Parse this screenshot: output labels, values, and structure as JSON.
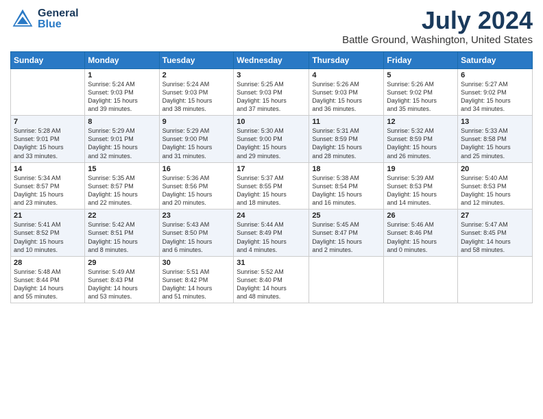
{
  "header": {
    "logo_general": "General",
    "logo_blue": "Blue",
    "title": "July 2024",
    "subtitle": "Battle Ground, Washington, United States"
  },
  "calendar": {
    "days": [
      "Sunday",
      "Monday",
      "Tuesday",
      "Wednesday",
      "Thursday",
      "Friday",
      "Saturday"
    ],
    "weeks": [
      [
        {
          "day": "",
          "content": ""
        },
        {
          "day": "1",
          "content": "Sunrise: 5:24 AM\nSunset: 9:03 PM\nDaylight: 15 hours\nand 39 minutes."
        },
        {
          "day": "2",
          "content": "Sunrise: 5:24 AM\nSunset: 9:03 PM\nDaylight: 15 hours\nand 38 minutes."
        },
        {
          "day": "3",
          "content": "Sunrise: 5:25 AM\nSunset: 9:03 PM\nDaylight: 15 hours\nand 37 minutes."
        },
        {
          "day": "4",
          "content": "Sunrise: 5:26 AM\nSunset: 9:03 PM\nDaylight: 15 hours\nand 36 minutes."
        },
        {
          "day": "5",
          "content": "Sunrise: 5:26 AM\nSunset: 9:02 PM\nDaylight: 15 hours\nand 35 minutes."
        },
        {
          "day": "6",
          "content": "Sunrise: 5:27 AM\nSunset: 9:02 PM\nDaylight: 15 hours\nand 34 minutes."
        }
      ],
      [
        {
          "day": "7",
          "content": "Sunrise: 5:28 AM\nSunset: 9:01 PM\nDaylight: 15 hours\nand 33 minutes."
        },
        {
          "day": "8",
          "content": "Sunrise: 5:29 AM\nSunset: 9:01 PM\nDaylight: 15 hours\nand 32 minutes."
        },
        {
          "day": "9",
          "content": "Sunrise: 5:29 AM\nSunset: 9:00 PM\nDaylight: 15 hours\nand 31 minutes."
        },
        {
          "day": "10",
          "content": "Sunrise: 5:30 AM\nSunset: 9:00 PM\nDaylight: 15 hours\nand 29 minutes."
        },
        {
          "day": "11",
          "content": "Sunrise: 5:31 AM\nSunset: 8:59 PM\nDaylight: 15 hours\nand 28 minutes."
        },
        {
          "day": "12",
          "content": "Sunrise: 5:32 AM\nSunset: 8:59 PM\nDaylight: 15 hours\nand 26 minutes."
        },
        {
          "day": "13",
          "content": "Sunrise: 5:33 AM\nSunset: 8:58 PM\nDaylight: 15 hours\nand 25 minutes."
        }
      ],
      [
        {
          "day": "14",
          "content": "Sunrise: 5:34 AM\nSunset: 8:57 PM\nDaylight: 15 hours\nand 23 minutes."
        },
        {
          "day": "15",
          "content": "Sunrise: 5:35 AM\nSunset: 8:57 PM\nDaylight: 15 hours\nand 22 minutes."
        },
        {
          "day": "16",
          "content": "Sunrise: 5:36 AM\nSunset: 8:56 PM\nDaylight: 15 hours\nand 20 minutes."
        },
        {
          "day": "17",
          "content": "Sunrise: 5:37 AM\nSunset: 8:55 PM\nDaylight: 15 hours\nand 18 minutes."
        },
        {
          "day": "18",
          "content": "Sunrise: 5:38 AM\nSunset: 8:54 PM\nDaylight: 15 hours\nand 16 minutes."
        },
        {
          "day": "19",
          "content": "Sunrise: 5:39 AM\nSunset: 8:53 PM\nDaylight: 15 hours\nand 14 minutes."
        },
        {
          "day": "20",
          "content": "Sunrise: 5:40 AM\nSunset: 8:53 PM\nDaylight: 15 hours\nand 12 minutes."
        }
      ],
      [
        {
          "day": "21",
          "content": "Sunrise: 5:41 AM\nSunset: 8:52 PM\nDaylight: 15 hours\nand 10 minutes."
        },
        {
          "day": "22",
          "content": "Sunrise: 5:42 AM\nSunset: 8:51 PM\nDaylight: 15 hours\nand 8 minutes."
        },
        {
          "day": "23",
          "content": "Sunrise: 5:43 AM\nSunset: 8:50 PM\nDaylight: 15 hours\nand 6 minutes."
        },
        {
          "day": "24",
          "content": "Sunrise: 5:44 AM\nSunset: 8:49 PM\nDaylight: 15 hours\nand 4 minutes."
        },
        {
          "day": "25",
          "content": "Sunrise: 5:45 AM\nSunset: 8:47 PM\nDaylight: 15 hours\nand 2 minutes."
        },
        {
          "day": "26",
          "content": "Sunrise: 5:46 AM\nSunset: 8:46 PM\nDaylight: 15 hours\nand 0 minutes."
        },
        {
          "day": "27",
          "content": "Sunrise: 5:47 AM\nSunset: 8:45 PM\nDaylight: 14 hours\nand 58 minutes."
        }
      ],
      [
        {
          "day": "28",
          "content": "Sunrise: 5:48 AM\nSunset: 8:44 PM\nDaylight: 14 hours\nand 55 minutes."
        },
        {
          "day": "29",
          "content": "Sunrise: 5:49 AM\nSunset: 8:43 PM\nDaylight: 14 hours\nand 53 minutes."
        },
        {
          "day": "30",
          "content": "Sunrise: 5:51 AM\nSunset: 8:42 PM\nDaylight: 14 hours\nand 51 minutes."
        },
        {
          "day": "31",
          "content": "Sunrise: 5:52 AM\nSunset: 8:40 PM\nDaylight: 14 hours\nand 48 minutes."
        },
        {
          "day": "",
          "content": ""
        },
        {
          "day": "",
          "content": ""
        },
        {
          "day": "",
          "content": ""
        }
      ]
    ]
  }
}
